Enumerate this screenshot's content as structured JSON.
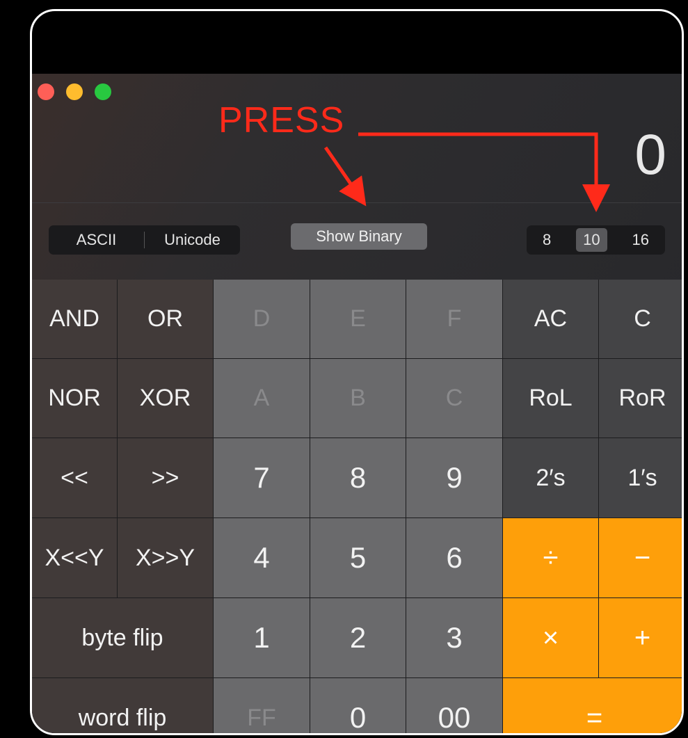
{
  "display": {
    "value": "0"
  },
  "mode_left": {
    "opt1": "ASCII",
    "opt2": "Unicode"
  },
  "binary_button": {
    "label": "Show Binary"
  },
  "base": {
    "b8": "8",
    "b10": "10",
    "b16": "16",
    "selected": "10"
  },
  "annotation": {
    "text": "PRESS",
    "color": "#ff2a1a"
  },
  "colors": {
    "operator": "#fe9f0a",
    "traffic_red": "#fe5f57",
    "traffic_yellow": "#febc2e",
    "traffic_green": "#28c840"
  },
  "keys": {
    "and": "AND",
    "or": "OR",
    "d": "D",
    "e": "E",
    "f": "F",
    "ac": "AC",
    "c_clear": "C",
    "nor": "NOR",
    "xor": "XOR",
    "a": "A",
    "b": "B",
    "c_hex": "C",
    "rol": "RoL",
    "ror": "RoR",
    "shl": "<<",
    "shr": ">>",
    "seven": "7",
    "eight": "8",
    "nine": "9",
    "twos": "2′s",
    "ones": "1′s",
    "xshly": "X<<Y",
    "xshry": "X>>Y",
    "four": "4",
    "five": "5",
    "six": "6",
    "divide": "÷",
    "minus": "−",
    "byte_flip": "byte flip",
    "one": "1",
    "two": "2",
    "three": "3",
    "multiply": "×",
    "plus": "+",
    "word_flip": "word flip",
    "ff": "FF",
    "zero": "0",
    "double_zero": "00",
    "equals": "="
  }
}
